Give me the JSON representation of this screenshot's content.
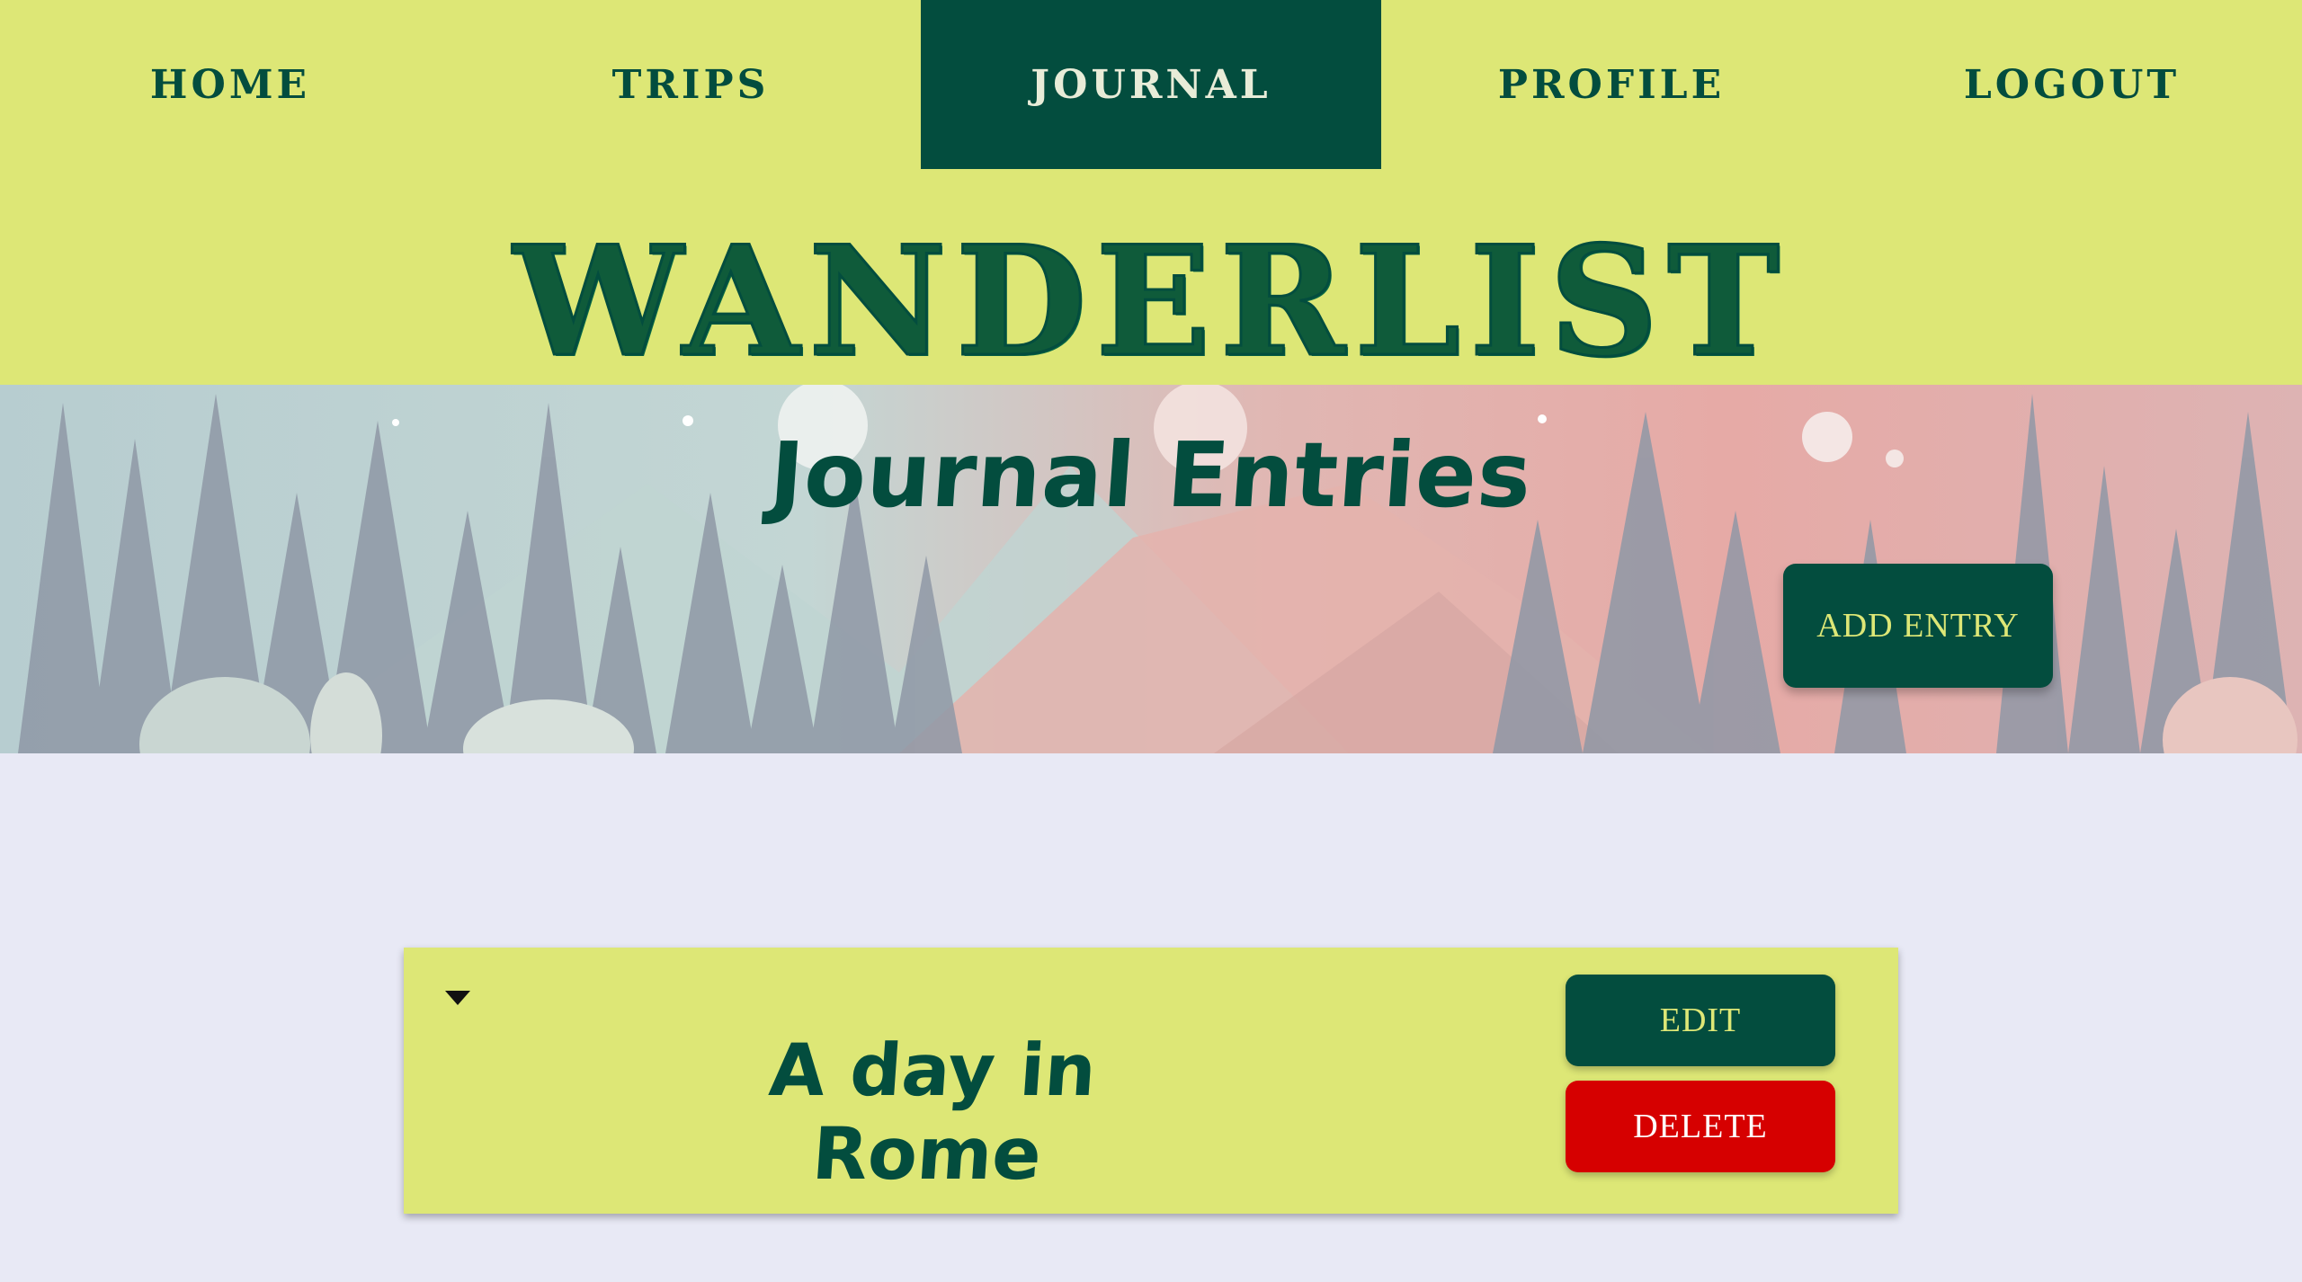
{
  "nav": {
    "items": [
      {
        "label": "HOME",
        "active": false
      },
      {
        "label": "TRIPS",
        "active": false
      },
      {
        "label": "JOURNAL",
        "active": true
      },
      {
        "label": "PROFILE",
        "active": false
      },
      {
        "label": "LOGOUT",
        "active": false
      }
    ]
  },
  "brand": {
    "title": "WANDERLIST"
  },
  "hero": {
    "title": "Journal Entries",
    "add_label": "ADD ENTRY"
  },
  "entries": [
    {
      "title": "A day in Rome",
      "edit_label": "EDIT",
      "delete_label": "DELETE"
    }
  ],
  "colors": {
    "accent": "#dde776",
    "primary": "#034d3e",
    "danger": "#d60000",
    "background": "#e8e9f5"
  },
  "icons": {
    "toggle": "triangle-down-icon"
  }
}
